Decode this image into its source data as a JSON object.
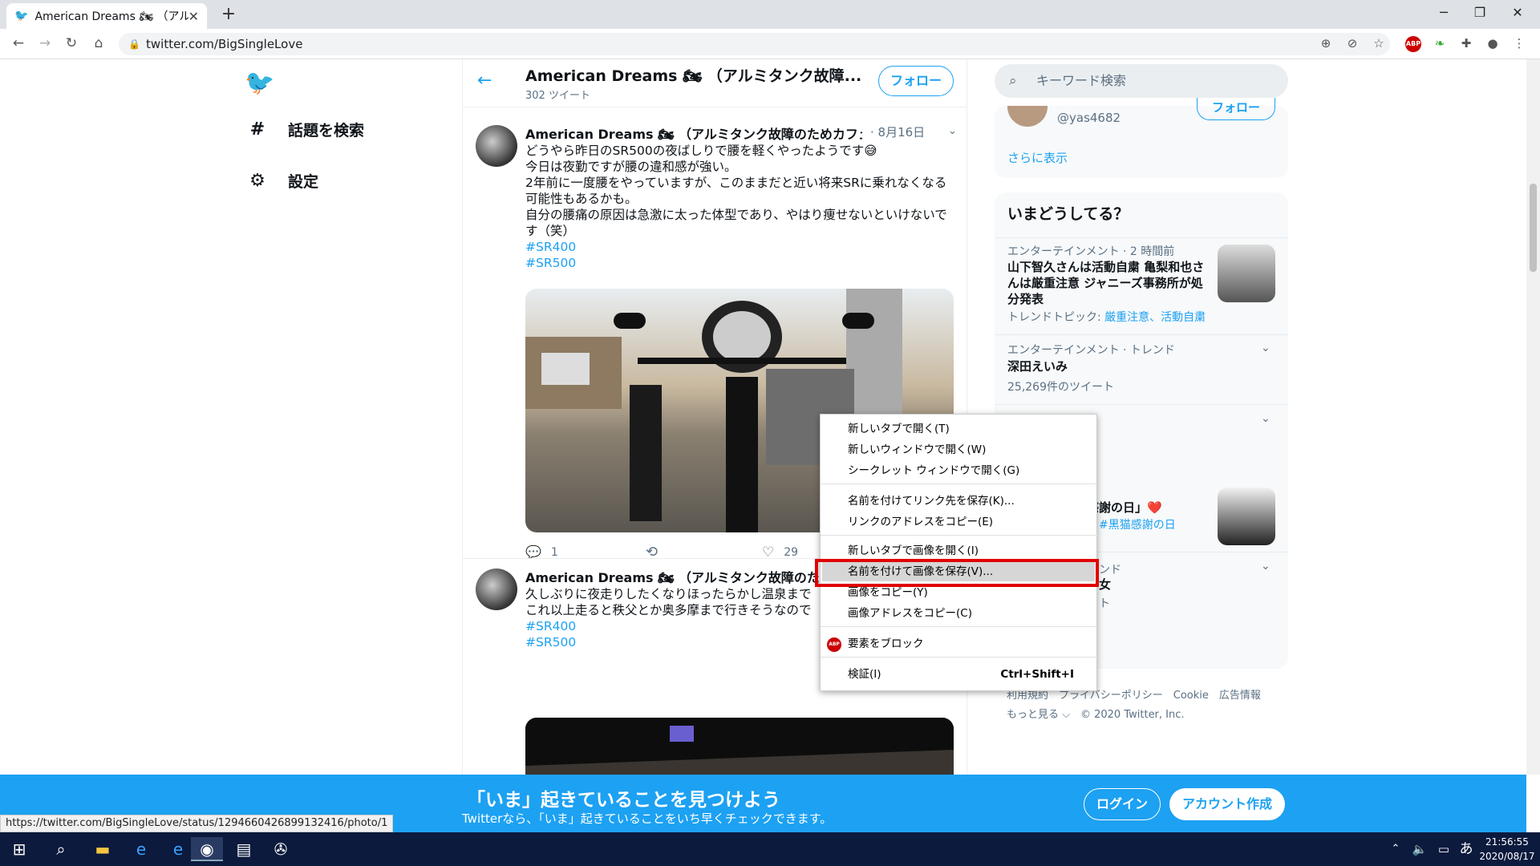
{
  "browser": {
    "tab_title": "American Dreams 🏍 （アルミ",
    "url": "twitter.com/BigSingleLove",
    "status_url": "https://twitter.com/BigSingleLove/status/1294660426899132416/photo/1"
  },
  "left_nav": {
    "explore": "話題を検索",
    "settings": "設定"
  },
  "profile": {
    "name": "American Dreams 🏍 （アルミタンク故障...",
    "tweet_count": "302 ツイート",
    "follow_label": "フォロー"
  },
  "tweets": [
    {
      "author": "American Dreams 🏍 （アルミタンク故障のためカフェレ...",
      "date": "· 8月16日",
      "lines": [
        "どうやら昨日のSR500の夜ばしりで腰を軽くやったようです😅",
        "今日は夜勤ですが腰の違和感が強い。",
        "2年前に一度腰をやっていますが、このままだと近い将来SRに乗れなくなる可能性もあるかも。",
        "自分の腰痛の原因は急激に太った体型であり、やはり痩せないといけないです（笑）"
      ],
      "hashtags": [
        "#SR400",
        "#SR500"
      ],
      "reply_count": "1",
      "like_count": "29"
    },
    {
      "author": "American Dreams 🏍 （アルミタンク故障のためカフ",
      "lines": [
        "久しぶりに夜走りしたくなりほったらかし温泉まで",
        "これ以上走ると秩父とか奥多摩まで行きそうなので"
      ],
      "hashtags": [
        "#SR400",
        "#SR500"
      ]
    }
  ],
  "right": {
    "search_placeholder": "キーワード検索",
    "who_to_follow_handle": "@yas4682",
    "who_to_follow_btn": "フォロー",
    "show_more": "さらに表示",
    "trends_title": "いまどうしてる？",
    "trend1": {
      "meta": "エンターテインメント · 2 時間前",
      "title": "山下智久さんは活動自粛 亀梨和也さんは厳重注意 ジャニーズ事務所が処分発表",
      "topic_prefix": "トレンドトピック: ",
      "topic_links": "厳重注意、活動自粛"
    },
    "trend2": {
      "meta": "エンターテインメント · トレンド",
      "title": "深田えいみ",
      "count": "25,269件のツイート"
    },
    "trend4": {
      "title": "猫感謝の日」❤️",
      "hashtag": "#黒猫感謝の日"
    },
    "trend5": {
      "meta": "ンド",
      "title": "女"
    },
    "trend5_partial": "ト",
    "footer1": "利用規約　プライバシーポリシー　Cookie　広告情報",
    "footer2": "もっと見る ⌵　© 2020 Twitter, Inc."
  },
  "context_menu": [
    {
      "label": "新しいタブで開く(T)"
    },
    {
      "label": "新しいウィンドウで開く(W)"
    },
    {
      "label": "シークレット ウィンドウで開く(G)"
    },
    {
      "label": "名前を付けてリンク先を保存(K)..."
    },
    {
      "label": "リンクのアドレスをコピー(E)"
    },
    {
      "label": "新しいタブで画像を開く(I)"
    },
    {
      "label": "名前を付けて画像を保存(V)..."
    },
    {
      "label": "画像をコピー(Y)"
    },
    {
      "label": "画像アドレスをコピー(C)"
    },
    {
      "label": "要素をブロック"
    },
    {
      "label": "検証(I)",
      "shortcut": "Ctrl+Shift+I"
    }
  ],
  "banner": {
    "title": "「いま」起きていることを見つけよう",
    "subtitle": "Twitterなら、「いま」起きていることをいち早くチェックできます。",
    "login": "ログイン",
    "signup": "アカウント作成"
  },
  "taskbar": {
    "time": "21:56:55",
    "date": "2020/08/17",
    "ime": "あ"
  },
  "colors": {
    "twitter_blue": "#1da1f2",
    "highlight_red": "#e00000",
    "taskbar": "#0b1a3d"
  }
}
